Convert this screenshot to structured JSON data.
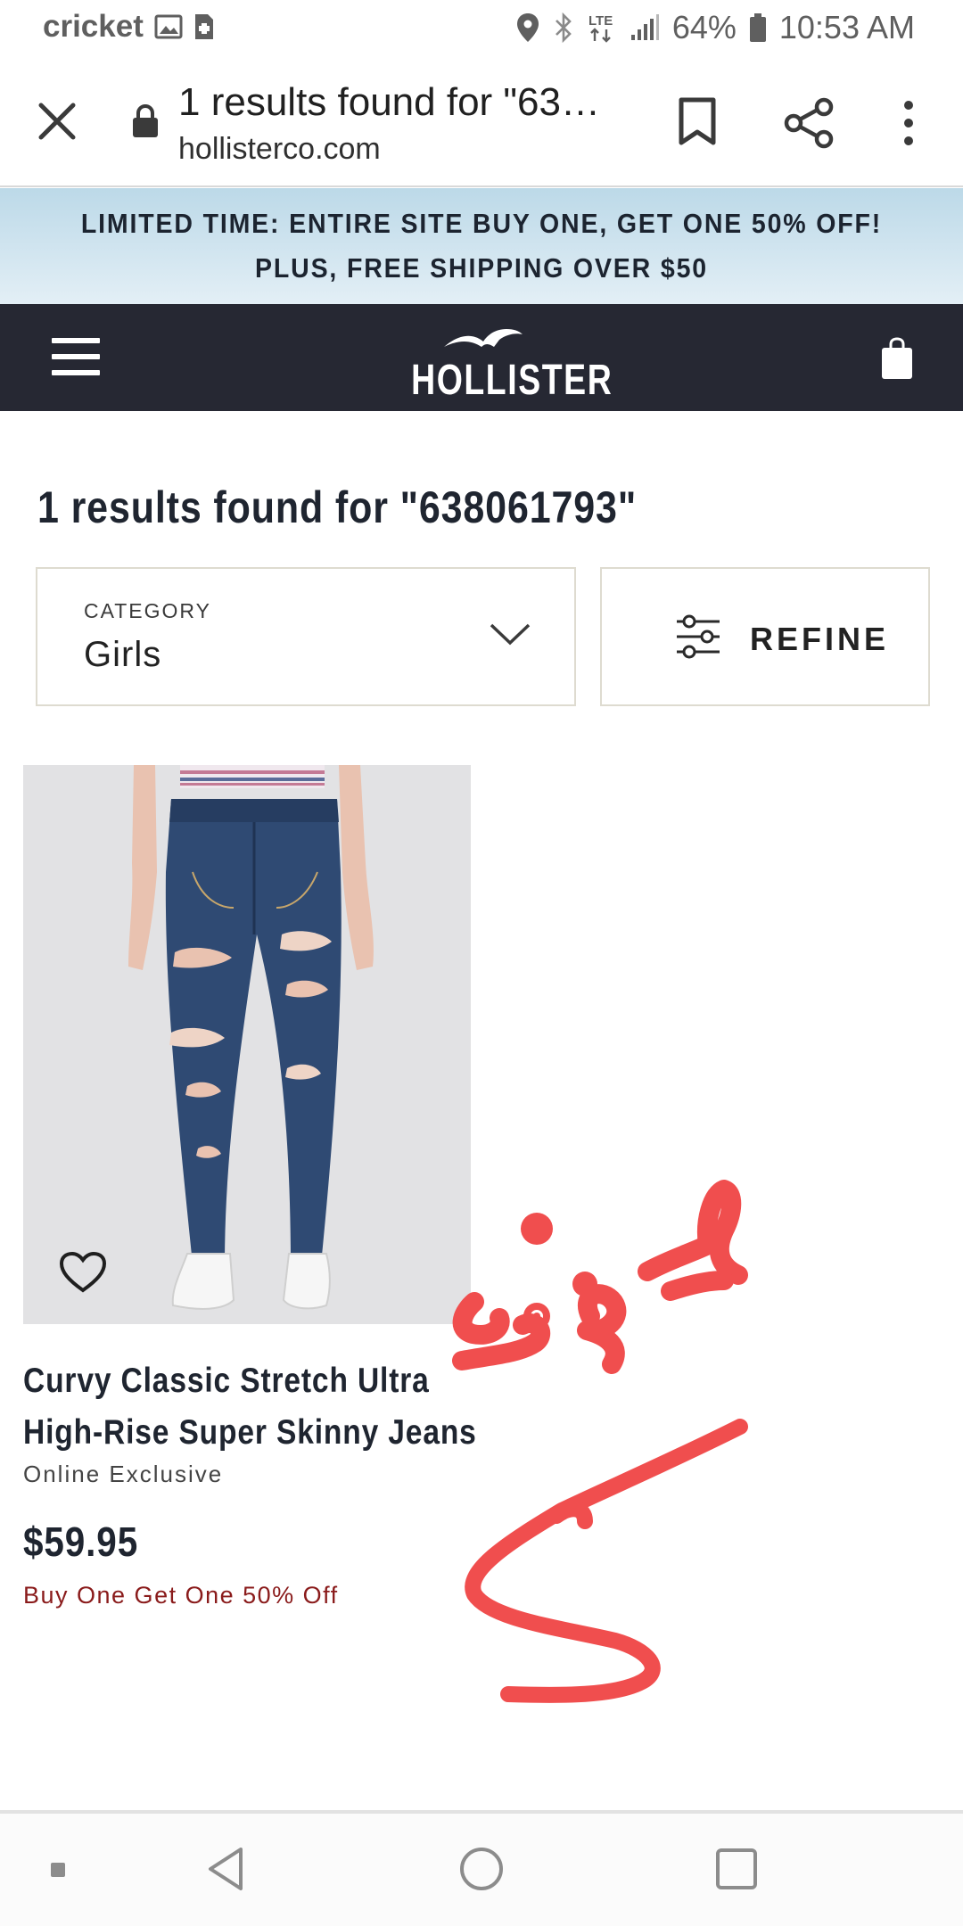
{
  "status_bar": {
    "carrier": "cricket",
    "network": "LTE",
    "battery": "64%",
    "time": "10:53 AM",
    "icons": [
      "image-icon",
      "sim-icon",
      "location-icon",
      "bluetooth-icon",
      "lte-icon",
      "signal-icon",
      "battery-icon"
    ]
  },
  "browser": {
    "page_title": "1 results found for \"63…",
    "domain": "hollisterco.com",
    "icons": [
      "close-icon",
      "lock-icon",
      "bookmark-icon",
      "share-icon",
      "more-vert-icon"
    ]
  },
  "promo": {
    "line1": "LIMITED TIME: ENTIRE SITE BUY ONE, GET ONE 50% OFF!",
    "line2": "PLUS, FREE SHIPPING OVER $50"
  },
  "header": {
    "logo_text": "HOLLISTER",
    "background": "#262833",
    "icons": [
      "menu-icon",
      "seagull-logo-icon",
      "shopping-bag-icon"
    ]
  },
  "results": {
    "title": "1 results found for \"638061793\"",
    "category_label": "CATEGORY",
    "category_value": "Girls",
    "refine_label": "REFINE"
  },
  "product": {
    "name_line1": "Curvy Classic Stretch Ultra",
    "name_line2": "High-Rise Super Skinny Jeans",
    "tag": "Online Exclusive",
    "price": "$59.95",
    "promo": "Buy One Get One 50% Off",
    "promo_color": "#8a1b1b"
  },
  "annotation": {
    "scribble_color": "#f04e4e"
  },
  "nav_bar": {
    "icons": [
      "recents-dot-icon",
      "back-icon",
      "home-icon",
      "overview-icon"
    ]
  }
}
